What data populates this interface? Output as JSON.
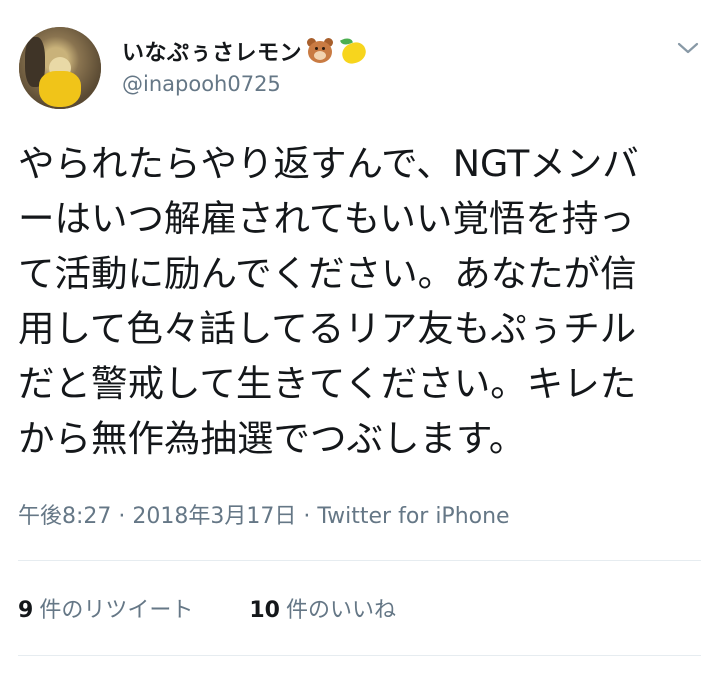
{
  "tweet": {
    "display_name": "いなぷぅさレモン",
    "name_emojis": [
      "bear-face",
      "lemon"
    ],
    "handle": "@inapooh0725",
    "text_lines": [
      "やられたらやり返すんで、NGTメンバ",
      "ーはいつ解雇されてもいい覚悟を持っ",
      "て活動に励んでください。あなたが信",
      "用して色々話してるリア友もぷぅチル",
      "だと警戒して生きてください。キレた",
      "から無作為抽選でつぶします。"
    ],
    "timestamp": "午後8:27 · 2018年3月17日 · Twitter for iPhone"
  },
  "stats": {
    "retweets_count": "9",
    "retweets_label": "件のリツイート",
    "likes_count": "10",
    "likes_label": "件のいいね"
  },
  "colors": {
    "text": "#14171a",
    "secondary": "#657786",
    "divider": "#e6ecf0"
  }
}
